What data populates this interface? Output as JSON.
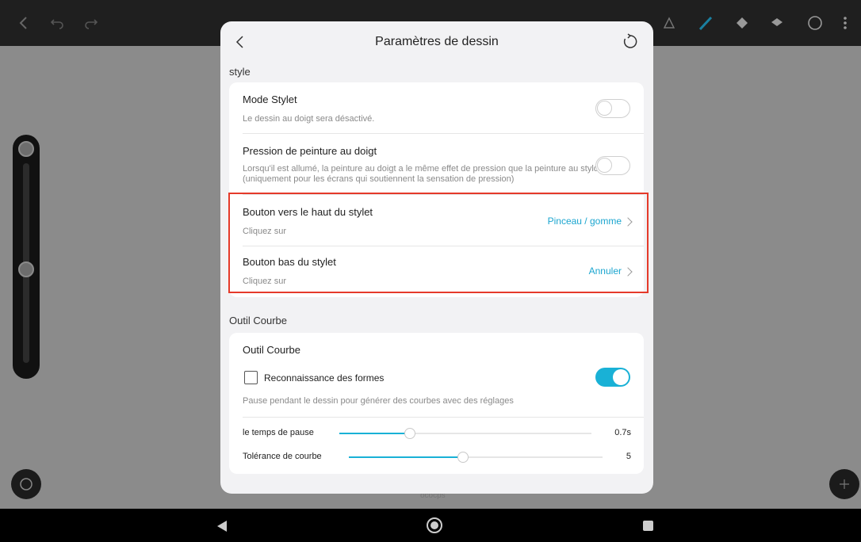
{
  "dialog": {
    "title": "Paramètres de dessin",
    "style_section": {
      "label": "style",
      "rows": [
        {
          "title": "Mode Stylet",
          "subtitle": "Le dessin au doigt sera désactivé.",
          "toggle": false
        },
        {
          "title": "Pression de peinture au doigt",
          "subtitle": "Lorsqu'il est allumé, la peinture au doigt a le même effet de pression que la peinture au stylo (uniquement pour les écrans qui soutiennent la sensation de pression)",
          "toggle": false
        },
        {
          "title": "Bouton vers le haut du stylet",
          "subtitle": "Cliquez sur",
          "value": "Pinceau / gomme"
        },
        {
          "title": "Bouton bas du stylet",
          "subtitle": "Cliquez sur",
          "value": "Annuler"
        }
      ]
    },
    "curve_section": {
      "label": "Outil Courbe",
      "card_title": "Outil Courbe",
      "shape_recognition": {
        "label": "Reconnaissance des formes",
        "checked": false,
        "toggle": true
      },
      "description": "Pause pendant le dessin pour générer des courbes avec des réglages",
      "sliders": [
        {
          "label": "le temps de pause",
          "value_text": "0.7s",
          "fraction": 0.28
        },
        {
          "label": "Tolérance de courbe",
          "value_text": "5",
          "fraction": 0.45
        }
      ]
    }
  },
  "behind_text": "ococps",
  "colors": {
    "accent": "#19b1d6",
    "highlight": "#e53a2a"
  },
  "icons": [
    "back-arrow-icon",
    "undo-icon",
    "redo-icon",
    "chevron-left-icon",
    "reset-icon",
    "chevron-right-icon",
    "brush-icon",
    "eraser-icon",
    "layers-icon",
    "color-circle-icon",
    "more-icon",
    "pencil-icon",
    "opacity-icon",
    "collapse-icon",
    "nav-back-icon",
    "nav-home-icon",
    "nav-recents-icon"
  ]
}
